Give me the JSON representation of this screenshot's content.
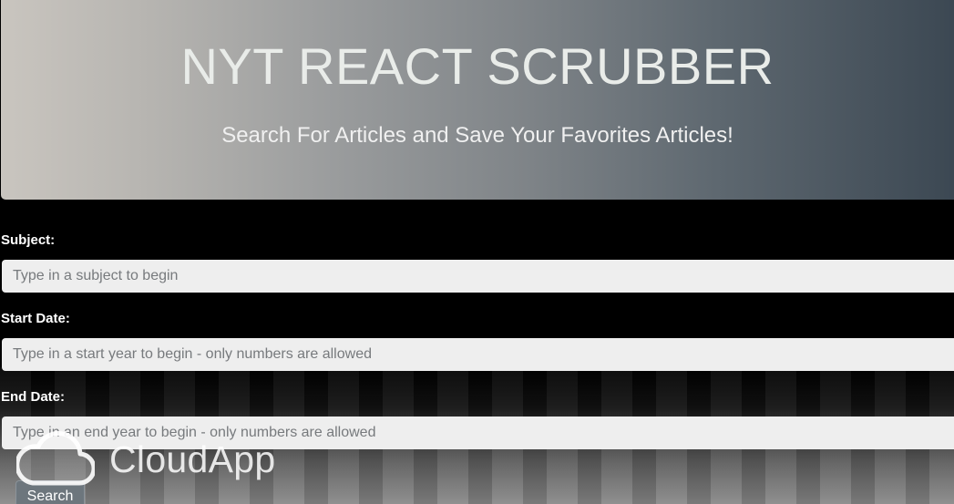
{
  "header": {
    "title": "NYT REACT SCRUBBER",
    "subtitle": "Search For Articles and Save Your Favorites Articles!"
  },
  "form": {
    "subject": {
      "label": "Subject:",
      "value": "",
      "placeholder": "Type in a subject to begin"
    },
    "start_date": {
      "label": "Start Date:",
      "value": "",
      "placeholder": "Type in a start year to begin - only numbers are allowed"
    },
    "end_date": {
      "label": "End Date:",
      "value": "",
      "placeholder": "Type in an end year to begin - only numbers are allowed"
    },
    "search_label": "Search"
  },
  "watermark": {
    "text": "CloudApp",
    "icon": "cloud-icon"
  }
}
